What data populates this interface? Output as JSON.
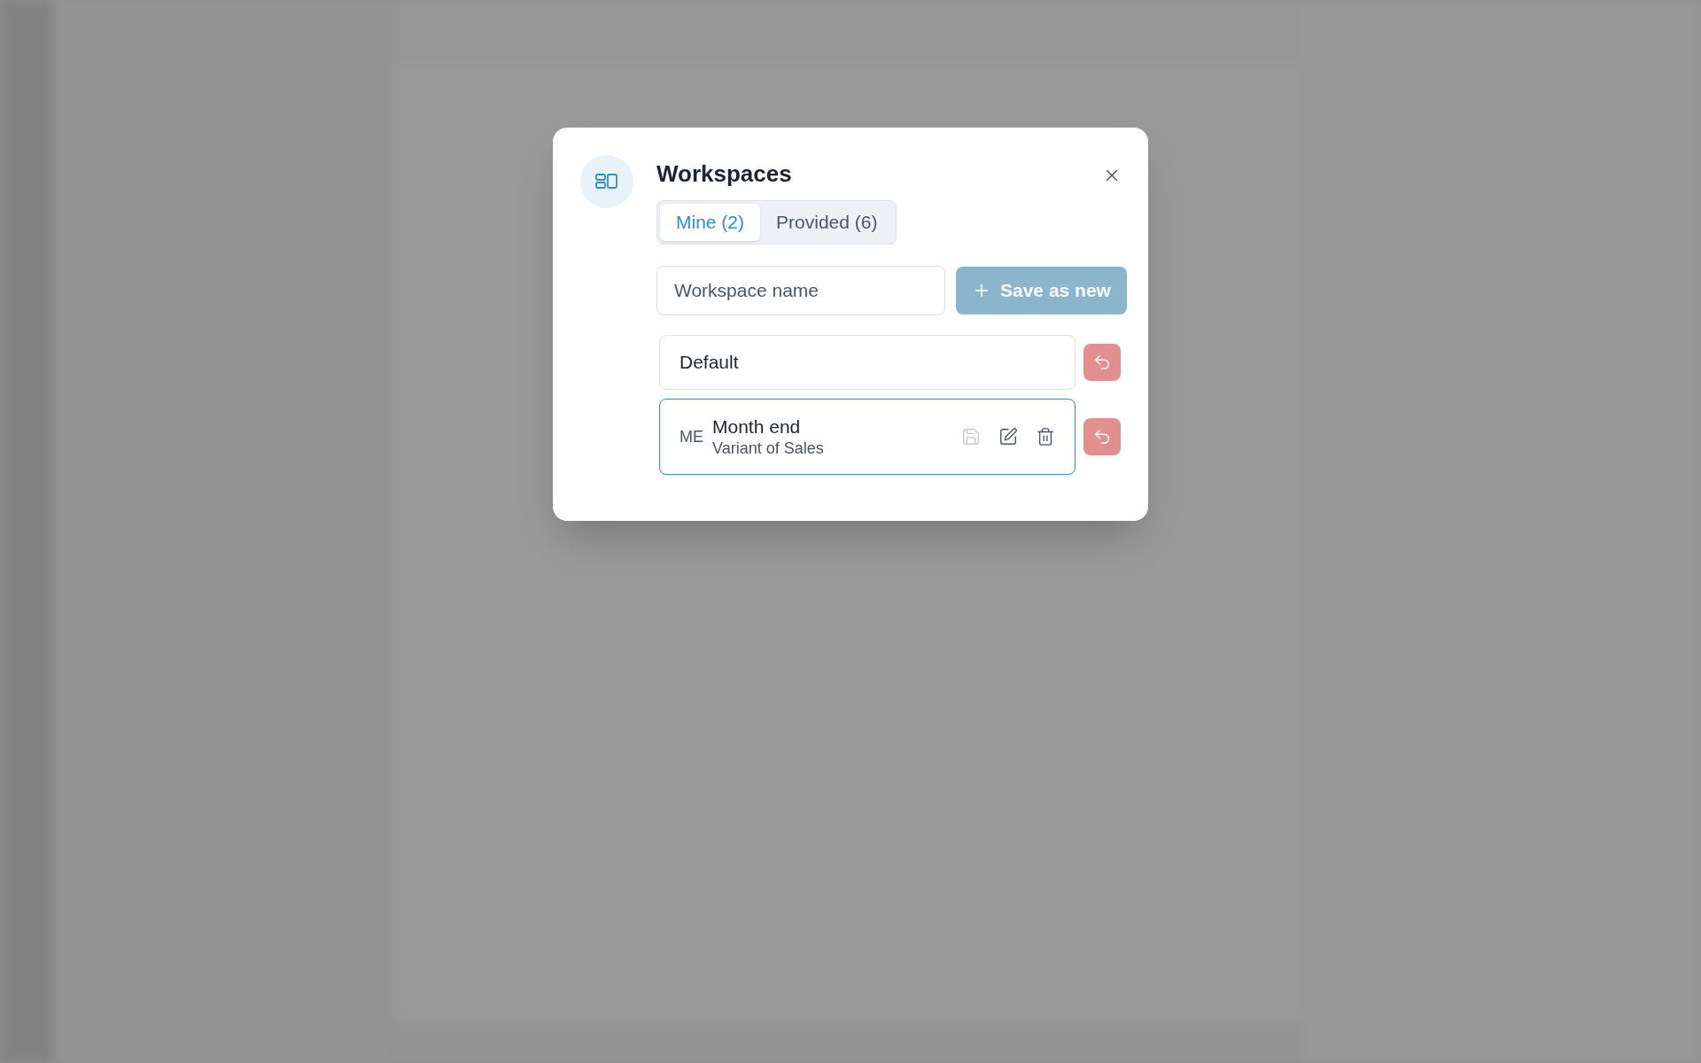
{
  "dialog": {
    "title": "Workspaces",
    "tabs": [
      {
        "label": "Mine (2)",
        "selected": true
      },
      {
        "label": "Provided (6)",
        "selected": false
      }
    ],
    "name_field": {
      "placeholder": "Workspace name"
    },
    "save_button": {
      "label": "Save as new",
      "disabled": true
    },
    "workspaces": [
      {
        "kind": "builtin",
        "name": "Default",
        "selected": false
      },
      {
        "kind": "custom",
        "initials": "ME",
        "name": "Month end",
        "subtitle": "Variant of Sales",
        "selected": true,
        "save_disabled": true
      }
    ]
  }
}
